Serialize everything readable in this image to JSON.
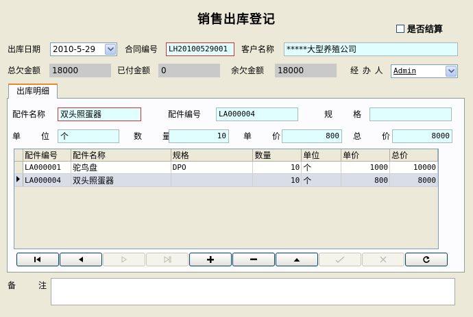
{
  "title": "销售出库登记",
  "settled": {
    "label": "是否结算",
    "checked": false
  },
  "header": {
    "out_date_label": "出库日期",
    "out_date_value": "2010-5-29",
    "contract_label": "合同编号",
    "contract_value": "LH20100529001",
    "customer_label": "客户名称",
    "customer_value": "*****大型养殖公司",
    "total_owed_label": "总欠金额",
    "total_owed_value": "18000",
    "paid_label": "已付金额",
    "paid_value": "0",
    "balance_label": "余欠金额",
    "balance_value": "18000",
    "handler_label": "经 办 人",
    "handler_value": "Admin"
  },
  "tab": {
    "label": "出库明细"
  },
  "detail": {
    "part_name_label": "配件名称",
    "part_name_value": "双头照蛋器",
    "part_no_label": "配件编号",
    "part_no_value": "LA000004",
    "spec_label": "规　　格",
    "spec_value": "",
    "unit_label": "单　　位",
    "unit_value": "个",
    "qty_label": "数　　量",
    "qty_value": "10",
    "price_label": "单　　价",
    "price_value": "800",
    "total_label": "总　　价",
    "total_value": "8000"
  },
  "grid": {
    "columns": [
      "配件编号",
      "配件名称",
      "规格",
      "数量",
      "单位",
      "单价",
      "总价"
    ],
    "rows": [
      {
        "part_no": "LA000001",
        "name": "驼鸟盘",
        "spec": "DPO",
        "qty": "10",
        "unit": "个",
        "price": "1000",
        "total": "10000",
        "selected": false
      },
      {
        "part_no": "LA000004",
        "name": "双头照蛋器",
        "spec": "",
        "qty": "10",
        "unit": "个",
        "price": "800",
        "total": "8000",
        "selected": true
      }
    ]
  },
  "navigator": [
    {
      "name": "first-record",
      "icon": "first-icon",
      "enabled": true
    },
    {
      "name": "prior-record",
      "icon": "prior-icon",
      "enabled": true
    },
    {
      "name": "next-record",
      "icon": "next-icon",
      "enabled": false
    },
    {
      "name": "last-record",
      "icon": "last-icon",
      "enabled": false
    },
    {
      "name": "insert-record",
      "icon": "plus-icon",
      "enabled": true
    },
    {
      "name": "delete-record",
      "icon": "minus-icon",
      "enabled": true
    },
    {
      "name": "edit-record",
      "icon": "up-arrow-icon",
      "enabled": true
    },
    {
      "name": "post-record",
      "icon": "check-icon",
      "enabled": false
    },
    {
      "name": "cancel-record",
      "icon": "x-icon",
      "enabled": false
    },
    {
      "name": "refresh-records",
      "icon": "refresh-icon",
      "enabled": true
    }
  ],
  "memo": {
    "label": "备　　注",
    "value": ""
  }
}
